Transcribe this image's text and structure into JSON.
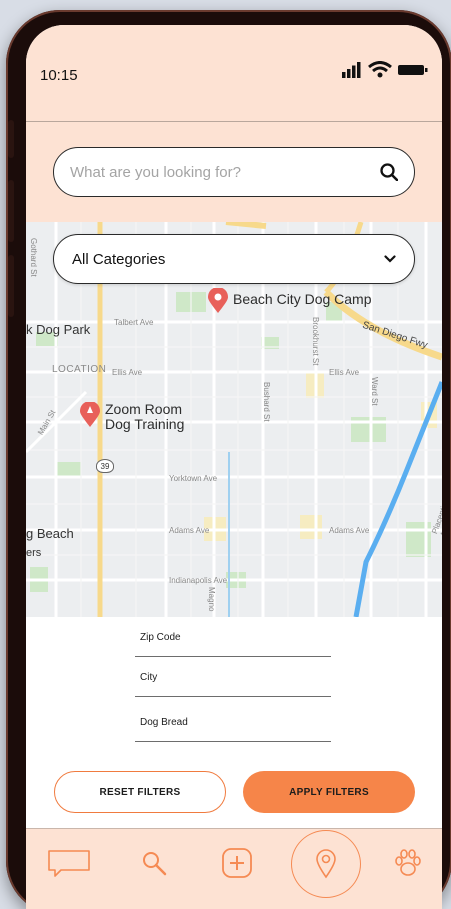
{
  "status_bar": {
    "time": "10:15"
  },
  "search": {
    "placeholder": "What are you looking for?"
  },
  "category": {
    "selected": "All Categories"
  },
  "map": {
    "places": [
      {
        "name": "Beach City Dog Camp"
      },
      {
        "name_line1": "Zoom Room",
        "name_line2": "Dog Training"
      }
    ],
    "labels": {
      "dog_park": "k Dog Park",
      "location": "LOCATION",
      "beach": "g Beach",
      "ers": "ers",
      "highway_39": "39"
    },
    "streets": {
      "talbert": "Talbert Ave",
      "ellis_left": "Ellis Ave",
      "ellis_right": "Ellis Ave",
      "yorktown": "Yorktown Ave",
      "adams_left": "Adams Ave",
      "adams_right": "Adams Ave",
      "indianapolis": "Indianapolis Ave",
      "san_diego_fwy": "San Diego Fwy",
      "gothard": "Gothard St",
      "brookhurst": "Brookhurst St",
      "bushard": "Bushard St",
      "ward": "Ward St",
      "main": "Main St",
      "placentia": "Placentia Ave",
      "magnolia": "Magno"
    }
  },
  "filters": {
    "zip_code": "Zip Code",
    "city": "City",
    "dog_breed": "Dog Bread",
    "reset_label": "RESET FILTERS",
    "apply_label": "APPLY FILTERS"
  },
  "colors": {
    "accent": "#f68549",
    "header_bg": "#fde2d3",
    "pin": "#e8605a",
    "water": "#5aaef0"
  },
  "nav": {
    "items": [
      "chat-icon",
      "search-icon",
      "add-icon",
      "map-pin-icon",
      "paw-icon"
    ],
    "active": "map-pin-icon"
  }
}
